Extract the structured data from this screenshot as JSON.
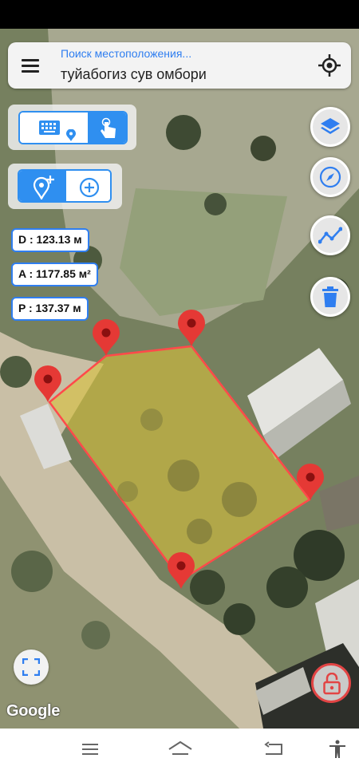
{
  "search": {
    "placeholder": "Поиск местоположения...",
    "value": "туйабогиз сув омбори"
  },
  "measurements": {
    "distance": "D : 123.13 м",
    "area": "A : 1177.85 м²",
    "perimeter": "P : 137.37 м"
  },
  "map": {
    "attribution": "Google",
    "polygon_fill": "#d8c23a",
    "polygon_stroke": "#ff4a4a",
    "marker_color": "#e53935",
    "accent": "#2f7ef0"
  },
  "icons": {
    "menu": "menu-icon",
    "locate": "crosshair-icon",
    "keyboard": "keyboard-icon",
    "touch": "touch-hand-icon",
    "add_marker": "add-location-icon",
    "add_point": "add-circle-icon",
    "layers": "layers-icon",
    "compass": "compass-icon",
    "elevation": "line-chart-icon",
    "delete": "trash-icon",
    "fullscreen": "fullscreen-icon",
    "lock": "lock-icon"
  },
  "navigation": {
    "buttons": [
      "menu-nav",
      "home-nav",
      "back-nav",
      "accessibility-nav"
    ]
  }
}
